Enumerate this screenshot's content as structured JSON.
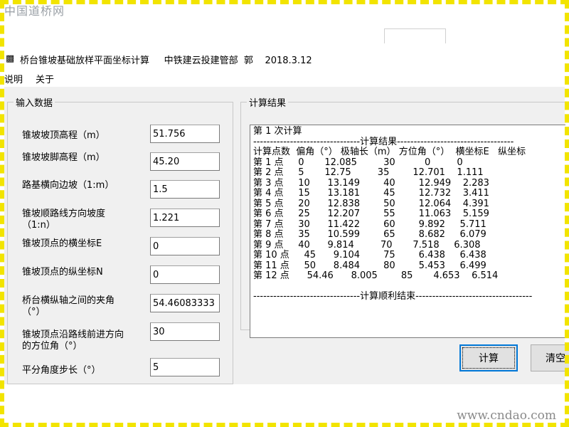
{
  "watermark": {
    "top": "中国道桥网",
    "bottom": "www.cndao.com"
  },
  "window": {
    "title": "桥台锥坡基础放样平面坐标计算     中铁建云投建管部  郭    2018.3.12"
  },
  "menu": [
    "说明",
    "关于"
  ],
  "input_group": {
    "title": "输入数据",
    "fields": [
      {
        "label": "锥坡坡顶高程（m）",
        "value": "51.756"
      },
      {
        "label": "锥坡坡脚高程（m）",
        "value": "45.20"
      },
      {
        "label": "路基横向边坡（1:m）",
        "value": "1.5"
      },
      {
        "label": "锥坡顺路线方向坡度（1:n）",
        "value": "1.221"
      },
      {
        "label": "锥坡顶点的横坐标E",
        "value": "0"
      },
      {
        "label": "锥坡顶点的纵坐标N",
        "value": "0"
      },
      {
        "label": "桥台横纵轴之间的夹角（°）",
        "value": "54.46083333"
      },
      {
        "label": "锥坡顶点沿路线前进方向的方位角（°）",
        "value": "30"
      },
      {
        "label": "平分角度步长（°）",
        "value": "5"
      }
    ]
  },
  "result_group": {
    "title": "计算结果",
    "lines": [
      "第 1 次计算",
      "--------------------------------计算结果-----------------------------------",
      "计算点数  偏角（°） 极轴长（m） 方位角（°）  横坐标E   纵坐标",
      "第 1 点     0       12.085         30          0         0",
      "第 2 点     5       12.75         35        12.701    1.111",
      "第 3 点     10      13.149        40        12.949    2.283",
      "第 4 点     15      13.181        45        12.732    3.411",
      "第 5 点     20      12.838        50        12.064    4.391",
      "第 6 点     25      12.207        55        11.063    5.159",
      "第 7 点     30      11.422        60        9.892     5.711",
      "第 8 点     35      10.599        65        8.682     6.079",
      "第 9 点     40      9.814         70       7.518     6.308",
      "第 10 点     45      9.104        75        6.438     6.438",
      "第 11 点     50      8.484        80        5.453     6.499",
      "第 12 点      54.46      8.005        85       4.653    6.514",
      "",
      "--------------------------------计算顺利结束-----------------------------------"
    ]
  },
  "buttons": {
    "calc": "计算",
    "clear": "清空"
  }
}
